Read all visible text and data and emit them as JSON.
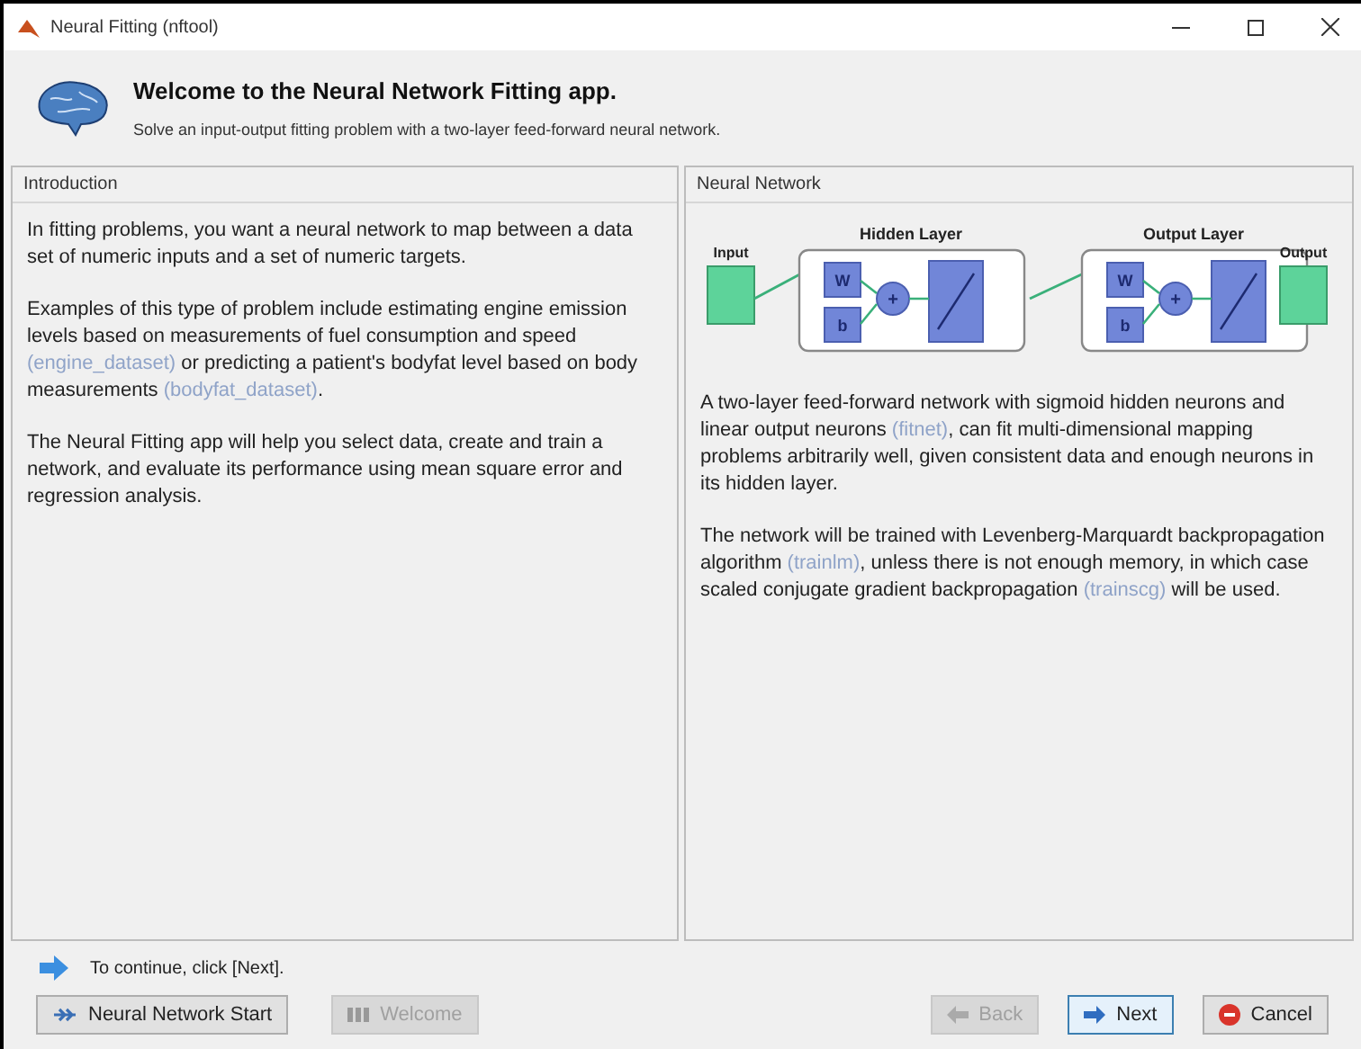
{
  "window": {
    "title": "Neural Fitting (nftool)"
  },
  "header": {
    "title": "Welcome to the Neural Network Fitting app.",
    "subtitle": "Solve an input-output fitting problem with a two-layer feed-forward neural network."
  },
  "introduction": {
    "title": "Introduction",
    "paragraphs": [
      [
        {
          "kind": "text",
          "text": "In fitting problems, you want a neural network to map between a data set of numeric inputs and a set of numeric targets."
        }
      ],
      [
        {
          "kind": "text",
          "text": "Examples of this type of problem include estimating engine emission levels based on measurements of fuel consumption and speed "
        },
        {
          "kind": "link",
          "text": "(engine_dataset)"
        },
        {
          "kind": "text",
          "text": " or predicting a patient's bodyfat level based on body measurements "
        },
        {
          "kind": "link",
          "text": "(bodyfat_dataset)"
        },
        {
          "kind": "text",
          "text": "."
        }
      ],
      [
        {
          "kind": "text",
          "text": "The Neural Fitting app will help you select data, create and train a network, and evaluate its performance using mean square error and regression analysis."
        }
      ]
    ]
  },
  "network": {
    "title": "Neural Network",
    "diagram": {
      "input": "Input",
      "layers": [
        {
          "title": "Hidden Layer",
          "weight": "W",
          "bias": "b",
          "sum": "+"
        },
        {
          "title": "Output Layer",
          "weight": "W",
          "bias": "b",
          "sum": "+"
        }
      ],
      "output": "Output"
    },
    "paragraphs": [
      [
        {
          "kind": "text",
          "text": "A two-layer feed-forward network with sigmoid hidden neurons and linear output neurons "
        },
        {
          "kind": "link",
          "text": "(fitnet)"
        },
        {
          "kind": "text",
          "text": ", can fit multi-dimensional mapping problems arbitrarily well, given consistent data and enough neurons in its hidden layer."
        }
      ],
      [
        {
          "kind": "text",
          "text": "The network will be trained with Levenberg-Marquardt backpropagation algorithm "
        },
        {
          "kind": "link",
          "text": "(trainlm)"
        },
        {
          "kind": "text",
          "text": ", unless there is not enough memory, in which case scaled conjugate gradient backpropagation "
        },
        {
          "kind": "link",
          "text": "(trainscg)"
        },
        {
          "kind": "text",
          "text": " will be used."
        }
      ]
    ]
  },
  "hint": "To continue, click [Next].",
  "buttons": [
    {
      "kind": "start",
      "label": "Neural Network Start",
      "disabled": false
    },
    {
      "kind": "welcome",
      "label": "Welcome",
      "disabled": true
    },
    {
      "kind": "back",
      "label": "Back",
      "disabled": true
    },
    {
      "kind": "next",
      "label": "Next",
      "disabled": false
    },
    {
      "kind": "cancel",
      "label": "Cancel",
      "disabled": false
    }
  ]
}
